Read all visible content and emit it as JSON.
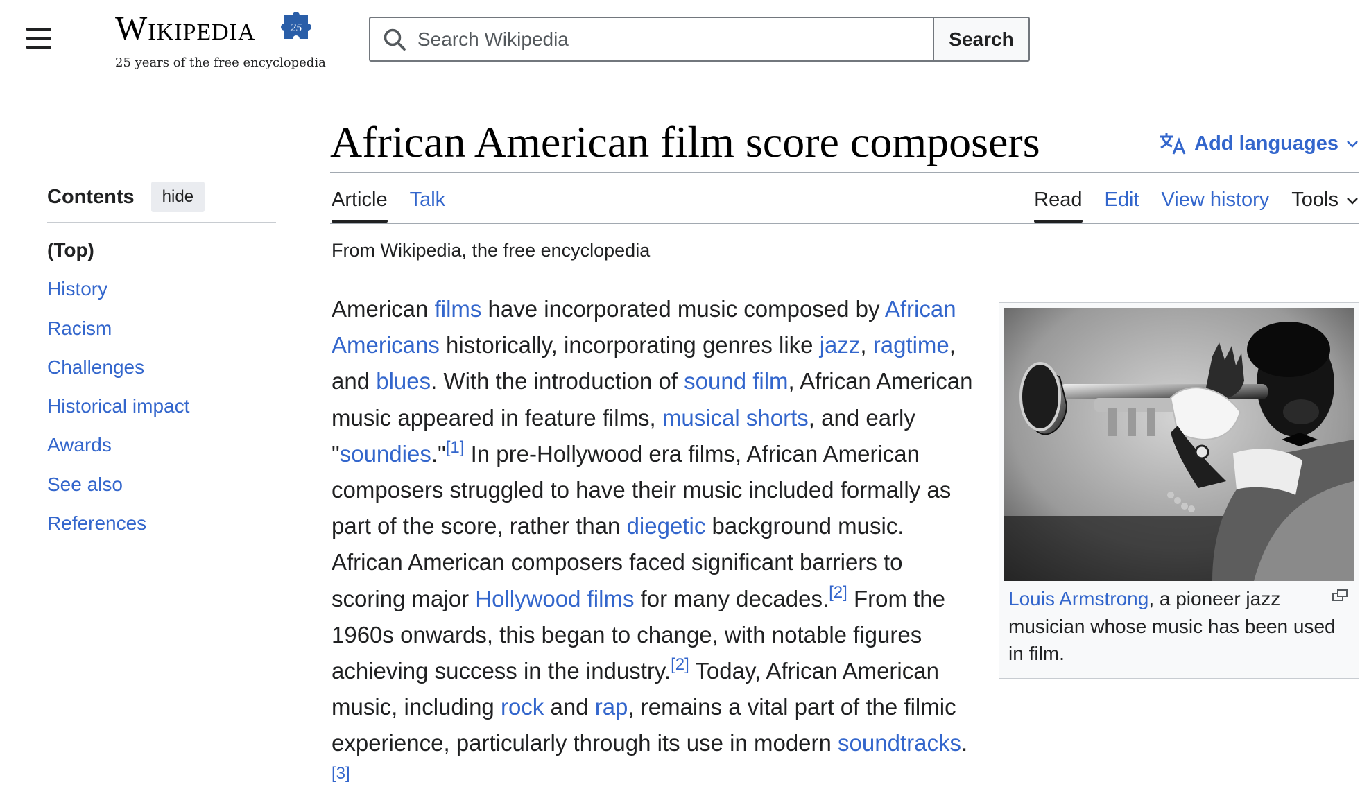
{
  "header": {
    "logo_wordmark": "Wikipedia",
    "logo_badge": "25",
    "tagline": "25 years of the free encyclopedia",
    "search_placeholder": "Search Wikipedia",
    "search_button": "Search"
  },
  "page": {
    "title": "African American film score composers",
    "add_languages": "Add languages",
    "tabs_left": [
      "Article",
      "Talk"
    ],
    "tabs_right": [
      "Read",
      "Edit",
      "View history",
      "Tools"
    ],
    "from_line": "From Wikipedia, the free encyclopedia"
  },
  "toc": {
    "title": "Contents",
    "hide_label": "hide",
    "items": [
      "(Top)",
      "History",
      "Racism",
      "Challenges",
      "Historical impact",
      "Awards",
      "See also",
      "References"
    ]
  },
  "article": {
    "segments": [
      {
        "t": "American "
      },
      {
        "t": "films",
        "link": true
      },
      {
        "t": " have incorporated music composed by "
      },
      {
        "t": "African Americans",
        "link": true
      },
      {
        "t": " historically, incorporating genres like "
      },
      {
        "t": "jazz",
        "link": true
      },
      {
        "t": ", "
      },
      {
        "t": "ragtime",
        "link": true
      },
      {
        "t": ", and "
      },
      {
        "t": "blues",
        "link": true
      },
      {
        "t": ". With the introduction of "
      },
      {
        "t": "sound film",
        "link": true
      },
      {
        "t": ", African American music appeared in feature films, "
      },
      {
        "t": "musical shorts",
        "link": true
      },
      {
        "t": ", and early \""
      },
      {
        "t": "soundies",
        "link": true
      },
      {
        "t": ".\""
      },
      {
        "t": "[1]",
        "sup": true
      },
      {
        "t": " In pre-Hollywood era films, African American composers struggled to have their music included formally as part of the score, rather than "
      },
      {
        "t": "diegetic",
        "link": true
      },
      {
        "t": " background music. African American composers faced significant barriers to scoring major "
      },
      {
        "t": "Hollywood films",
        "link": true
      },
      {
        "t": " for many decades."
      },
      {
        "t": "[2]",
        "sup": true
      },
      {
        "t": " From the 1960s onwards, this began to change, with notable figures achieving success in the industry."
      },
      {
        "t": "[2]",
        "sup": true
      },
      {
        "t": " Today, African American music, including "
      },
      {
        "t": "rock",
        "link": true
      },
      {
        "t": " and "
      },
      {
        "t": "rap",
        "link": true
      },
      {
        "t": ", remains a vital part of the filmic experience, particularly through its use in modern "
      },
      {
        "t": "soundtracks",
        "link": true
      },
      {
        "t": "."
      },
      {
        "t": "[3]",
        "sup": true
      }
    ]
  },
  "thumb": {
    "caption_link": "Louis Armstrong",
    "caption_rest": ", a pioneer jazz musician whose music has been used in film."
  },
  "icons": {
    "menu": "hamburger-menu-icon",
    "search": "search-icon",
    "translate": "translate-icon",
    "chevron": "chevron-down-icon",
    "magnify": "enlarge-icon"
  },
  "colors": {
    "link": "#3366cc",
    "text": "#202122",
    "border": "#a2a9b1",
    "badge_blue": "#2a5ea8"
  }
}
